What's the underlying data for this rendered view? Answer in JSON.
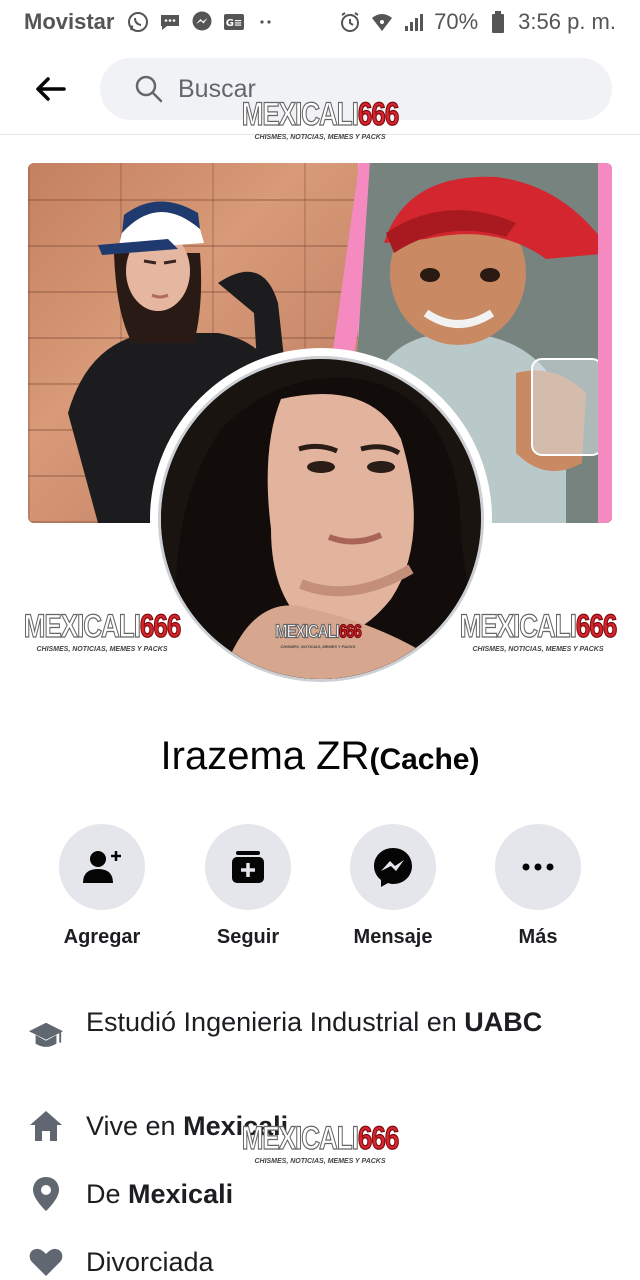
{
  "status_bar": {
    "carrier": "Movistar",
    "left_icons": [
      "whatsapp-icon",
      "chat-bubble-icon",
      "messenger-icon",
      "gmail-icon",
      "dots-icon"
    ],
    "right_icons": [
      "alarm-icon",
      "wifi-icon",
      "signal-icon",
      "battery-icon"
    ],
    "battery": "70%",
    "time": "3:56 p. m."
  },
  "topbar": {
    "back_icon": "back-arrow-icon",
    "search_icon": "search-icon",
    "search_placeholder": "Buscar"
  },
  "watermark": {
    "brand_a": "MEXICALI",
    "brand_b": "666",
    "tagline": "CHISMES, NOTICIAS, MEMES Y PACKS"
  },
  "profile": {
    "name": "Irazema ZR",
    "alternate_name": "(Cache)"
  },
  "actions": [
    {
      "label": "Agregar",
      "icon": "add-friend-icon"
    },
    {
      "label": "Seguir",
      "icon": "follow-icon"
    },
    {
      "label": "Mensaje",
      "icon": "messenger-icon"
    },
    {
      "label": "Más",
      "icon": "more-icon"
    }
  ],
  "details": {
    "education": {
      "prefix": "Estudió Ingenieria Industrial en ",
      "place": "UABC",
      "icon": "graduation-cap-icon"
    },
    "lives": {
      "prefix": "Vive en ",
      "place": "Mexicali",
      "icon": "home-icon"
    },
    "from": {
      "prefix": "De ",
      "place": "Mexicali",
      "icon": "location-pin-icon"
    },
    "relationship": {
      "text": "Divorciada",
      "icon": "heart-icon"
    }
  },
  "colors": {
    "accent_pink": "#f48ac0",
    "button_bg": "#e4e6eb",
    "search_bg": "#f0f2f5",
    "watermark_red": "#d8242b"
  }
}
